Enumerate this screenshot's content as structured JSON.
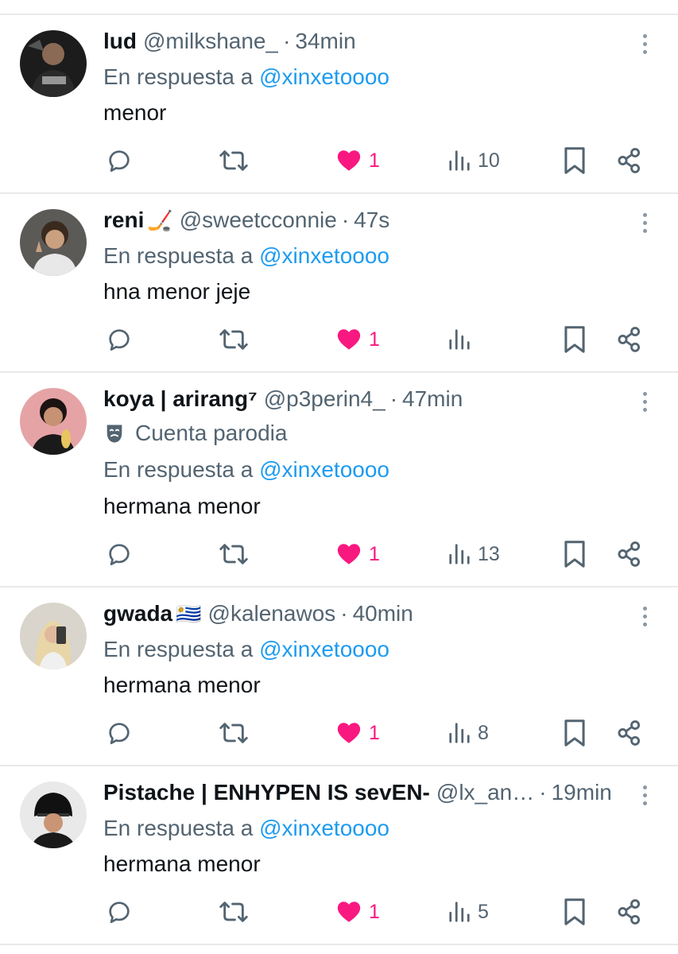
{
  "reply_prefix": "En respuesta a",
  "icons": {
    "reply": "reply-icon",
    "retweet": "retweet-icon",
    "like": "heart-icon",
    "views": "views-icon",
    "bookmark": "bookmark-icon",
    "share": "share-icon",
    "more": "more-icon",
    "parody": "theater-mask-icon"
  },
  "colors": {
    "like": "#f91880",
    "mention": "#1d9bf0",
    "muted": "#536471"
  },
  "tweets": [
    {
      "name": "lud",
      "name_emoji": "",
      "handle": "@milkshane_",
      "time": "34min",
      "badge": "",
      "reply_to": "@xinxetoooo",
      "text": "menor",
      "likes": "1",
      "views": "10",
      "liked": true
    },
    {
      "name": "reni",
      "name_emoji": "🏒",
      "handle": "@sweetcconnie",
      "time": "47s",
      "badge": "",
      "reply_to": "@xinxetoooo",
      "text": "hna menor jeje",
      "likes": "1",
      "views": "",
      "liked": true
    },
    {
      "name": "koya | arirang⁷",
      "name_emoji": "",
      "handle": "@p3perin4_",
      "time": "47min",
      "badge": "Cuenta parodia",
      "reply_to": "@xinxetoooo",
      "text": "hermana menor",
      "likes": "1",
      "views": "13",
      "liked": true
    },
    {
      "name": "gwada",
      "name_emoji": "🇺🇾",
      "handle": "@kalenawos",
      "time": "40min",
      "badge": "",
      "reply_to": "@xinxetoooo",
      "text": "hermana menor",
      "likes": "1",
      "views": "8",
      "liked": true
    },
    {
      "name": "Pistache | ENHYPEN IS sevEN-",
      "name_emoji": "",
      "handle": "@lx_an…",
      "time": "19min",
      "badge": "",
      "reply_to": "@xinxetoooo",
      "text": "hermana menor",
      "likes": "1",
      "views": "5",
      "liked": true
    }
  ]
}
